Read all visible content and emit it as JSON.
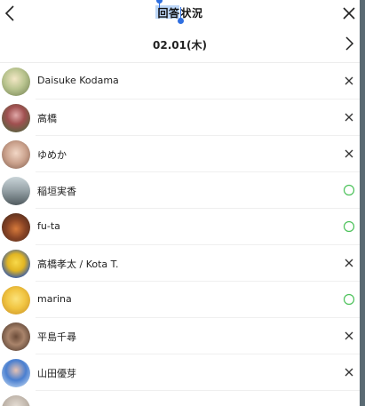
{
  "header": {
    "title_selected": "回答",
    "title_rest": "状況"
  },
  "date": {
    "label": "02.01(木)"
  },
  "participants": [
    {
      "name": "Daisuke Kodama",
      "status": "x"
    },
    {
      "name": "高橋",
      "status": "x"
    },
    {
      "name": "ゆめか",
      "status": "x"
    },
    {
      "name": "稲垣実香",
      "status": "o"
    },
    {
      "name": "fu-ta",
      "status": "o"
    },
    {
      "name": "高橋孝太 / Kota T.",
      "status": "x"
    },
    {
      "name": "marina",
      "status": "o"
    },
    {
      "name": "平島千尋",
      "status": "x"
    },
    {
      "name": "山田優芽",
      "status": "x"
    }
  ],
  "colors": {
    "available": "#4cc25a",
    "unavailable": "#333333",
    "selection": "#bcd6f7",
    "handle": "#2f6fe0"
  }
}
